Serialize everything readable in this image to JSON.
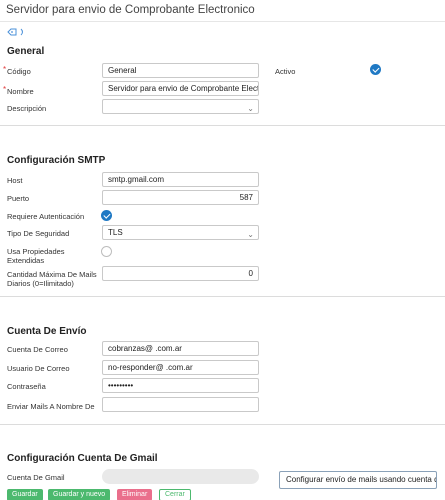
{
  "header": {
    "title": "Servidor para envio de Comprobante Electronico"
  },
  "general": {
    "section_title": "General",
    "codigo_label": "Código",
    "codigo_value": "General",
    "nombre_label": "Nombre",
    "nombre_value": "Servidor para envio de Comprobante Electronico",
    "descripcion_label": "Descripción",
    "descripcion_value": "",
    "activo_label": "Activo",
    "activo_checked": true
  },
  "smtp": {
    "section_title": "Configuración SMTP",
    "host_label": "Host",
    "host_value": "smtp.gmail.com",
    "puerto_label": "Puerto",
    "puerto_value": "587",
    "requiere_auth_label": "Requiere Autenticación",
    "requiere_auth_checked": true,
    "tipo_seguridad_label": "Tipo De Seguridad",
    "tipo_seguridad_value": "TLS",
    "usa_propiedades_label": "Usa Propiedades Extendidas",
    "usa_propiedades_checked": false,
    "cantidad_max_label": "Cantidad Máxima De Mails Diarios (0=Ilimitado)",
    "cantidad_max_value": "0"
  },
  "cuenta_envio": {
    "section_title": "Cuenta De Envío",
    "cuenta_correo_label": "Cuenta De Correo",
    "cuenta_correo_value": "cobranzas@            .com.ar",
    "usuario_correo_label": "Usuario De Correo",
    "usuario_correo_value": "no-responder@           .com.ar",
    "contrasena_label": "Contraseña",
    "contrasena_value": "•••••••••",
    "enviar_nombre_label": "Enviar Mails A Nombre De",
    "enviar_nombre_value": ""
  },
  "gmail": {
    "section_title": "Configuración Cuenta De Gmail",
    "cuenta_gmail_label": "Cuenta De Gmail",
    "cuenta_gmail_value": "",
    "configurar_button": "Configurar envío de mails usando cuenta de"
  },
  "actions": {
    "guardar": "Guardar",
    "guardar_nuevo": "Guardar y nuevo",
    "eliminar": "Eliminar",
    "cerrar": "Cerrar"
  },
  "colors": {
    "accent_blue": "#1f79c4",
    "green": "#4cb96e",
    "pink": "#ea6f8c",
    "required": "#e23b3b"
  },
  "icons": {
    "tag": "tag-icon",
    "check": "check-circle-icon",
    "chevron": "chevron-down-icon"
  }
}
